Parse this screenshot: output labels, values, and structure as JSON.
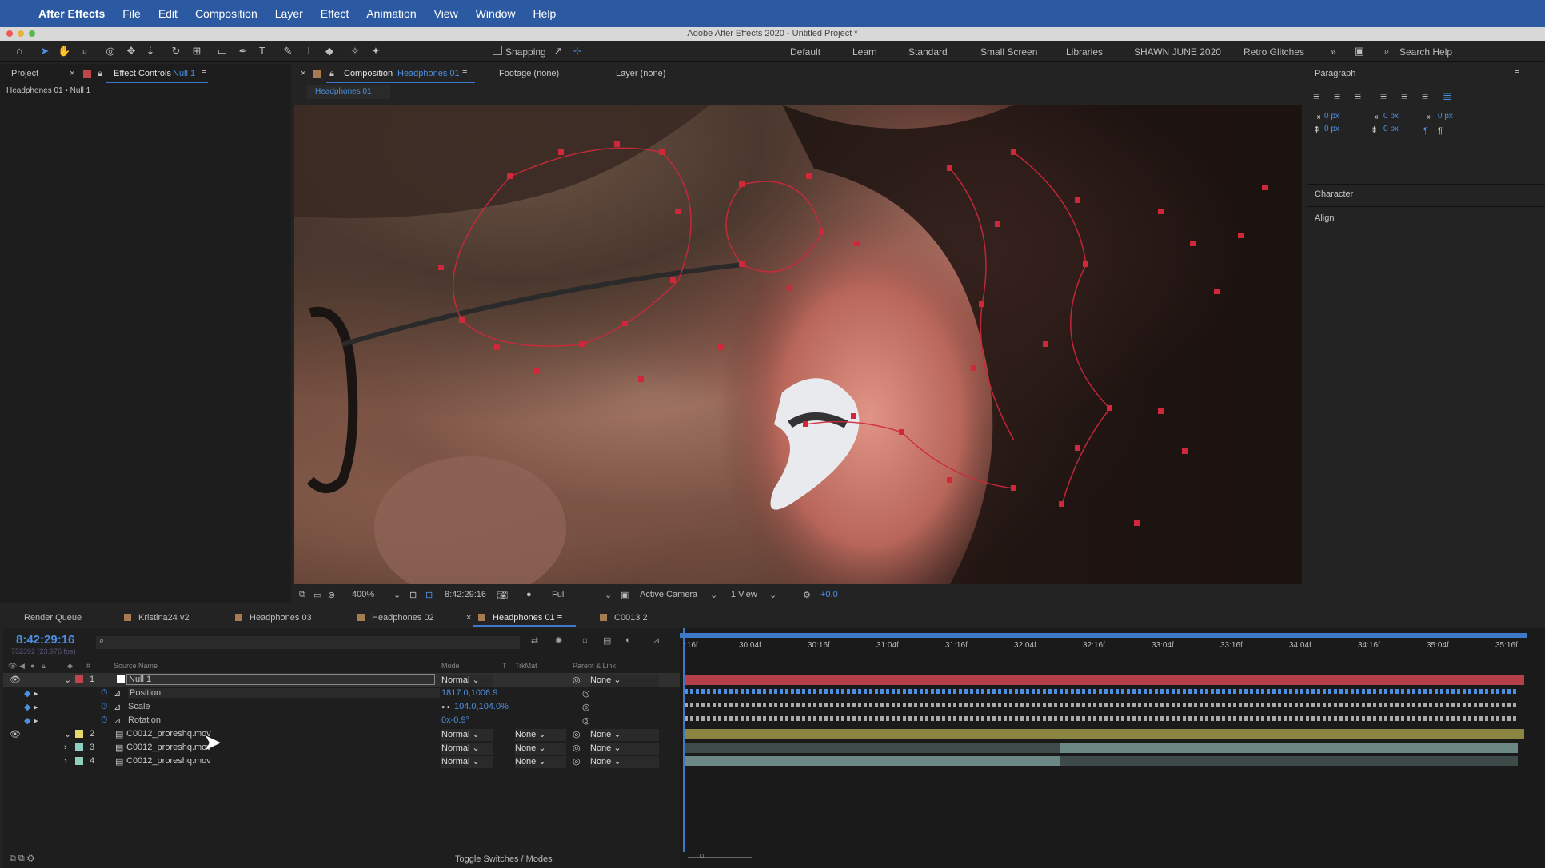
{
  "menubar": {
    "app": "After Effects",
    "items": [
      "File",
      "Edit",
      "Composition",
      "Layer",
      "Effect",
      "Animation",
      "View",
      "Window",
      "Help"
    ]
  },
  "window": {
    "title": "Adobe After Effects 2020 - Untitled Project *"
  },
  "toolbar": {
    "snapping": "Snapping",
    "workspaces": [
      "Default",
      "Learn",
      "Standard",
      "Small Screen",
      "Libraries",
      "SHAWN JUNE 2020",
      "Retro Glitches"
    ],
    "search": "Search Help"
  },
  "left_panel": {
    "tab_project": "Project",
    "tab_effect_controls": "Effect Controls",
    "tab_effect_target": "Null 1",
    "subtitle": "Headphones 01 • Null 1"
  },
  "comp_panel": {
    "tab_label": "Composition",
    "comp_name": "Headphones 01",
    "footage": "Footage (none)",
    "layer": "Layer (none)",
    "breadcrumb": "Headphones 01"
  },
  "viewer": {
    "zoom": "400%",
    "timecode": "8:42:29:16",
    "resolution": "Full",
    "camera": "Active Camera",
    "views": "1 View",
    "exposure": "+0.0"
  },
  "right_panel": {
    "paragraph": "Paragraph",
    "character": "Character",
    "align": "Align",
    "px": "0 px"
  },
  "timeline_tabs": [
    "Render Queue",
    "Kristina24 v2",
    "Headphones 03",
    "Headphones 02",
    "Headphones 01",
    "C0013 2"
  ],
  "timeline_tab_colors": [
    "",
    "#a57c52",
    "#a57c52",
    "#a57c52",
    "#a57c52",
    "#a57c52"
  ],
  "timeline": {
    "timecode": "8:42:29:16",
    "frames": "752392 (23.976 fps)",
    "headers": {
      "num": "#",
      "source": "Source Name",
      "mode": "Mode",
      "t": "T",
      "trkmat": "TrkMat",
      "parent": "Parent & Link"
    },
    "ruler": [
      "30:04f",
      "30:16f",
      "31:04f",
      "31:16f",
      "32:04f",
      "32:16f",
      "33:04f",
      "33:16f",
      "34:04f",
      "34:16f",
      "35:04f",
      "35:16f"
    ],
    "ruler_start": ":16f",
    "layers": [
      {
        "num": "1",
        "name": "Null 1",
        "mode": "Normal",
        "trkmat": "",
        "parent": "None",
        "color": "#c0464a"
      },
      {
        "num": "2",
        "name": "C0012_proreshq.mov",
        "mode": "Normal",
        "trkmat": "None",
        "parent": "None",
        "color": "#e7d86b"
      },
      {
        "num": "3",
        "name": "C0012_proreshq.mov",
        "mode": "Normal",
        "trkmat": "None",
        "parent": "None",
        "color": "#8ecfc1"
      },
      {
        "num": "4",
        "name": "C0012_proreshq.mov",
        "mode": "Normal",
        "trkmat": "None",
        "parent": "None",
        "color": "#8ecfc1"
      }
    ],
    "props": [
      {
        "name": "Position",
        "value": "1817.0,1006.9"
      },
      {
        "name": "Scale",
        "value": "104.0,104.0%"
      },
      {
        "name": "Rotation",
        "value": "0x-0.9°"
      }
    ],
    "footer": "Toggle Switches / Modes"
  }
}
